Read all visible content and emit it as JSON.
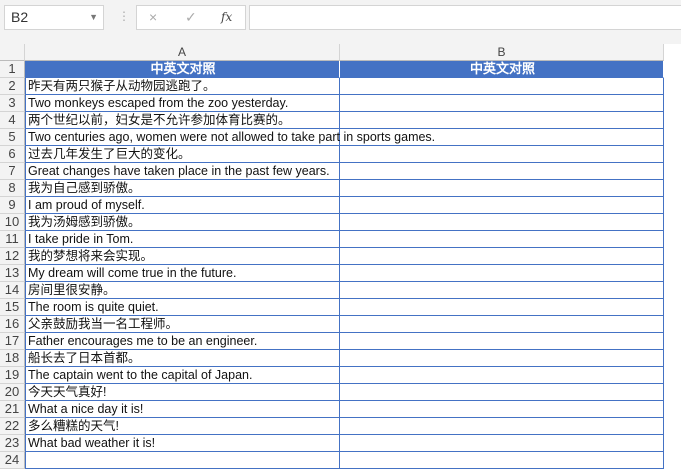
{
  "name_box": "B2",
  "formula_bar": {
    "cancel_icon": "×",
    "enter_icon": "✓",
    "fx_label": "fx",
    "value": ""
  },
  "columns": [
    "A",
    "B"
  ],
  "header_row": {
    "A": "中英文对照",
    "B": "中英文对照"
  },
  "rows": [
    "昨天有两只猴子从动物园逃跑了。",
    "Two monkeys escaped from the zoo yesterday.",
    "两个世纪以前，妇女是不允许参加体育比赛的。",
    "Two centuries ago, women were not allowed to take part in sports games.",
    "过去几年发生了巨大的变化。",
    "Great changes have taken place in the past few years.",
    "我为自己感到骄傲。",
    "I am proud of myself.",
    "我为汤姆感到骄傲。",
    "I take pride in Tom.",
    "我的梦想将来会实现。",
    "My dream will come true in the future.",
    "房间里很安静。",
    "The room is quite quiet.",
    "父亲鼓励我当一名工程师。",
    "Father encourages me to be an engineer.",
    "船长去了日本首都。",
    "The captain went to the capital of Japan.",
    "今天天气真好!",
    "What a nice day it is!",
    "多么糟糕的天气!",
    "What bad weather it is!"
  ],
  "row_numbers": [
    "1",
    "2",
    "3",
    "4",
    "5",
    "6",
    "7",
    "8",
    "9",
    "10",
    "11",
    "12",
    "13",
    "14",
    "15",
    "16",
    "17",
    "18",
    "19",
    "20",
    "21",
    "22",
    "23",
    "24"
  ]
}
